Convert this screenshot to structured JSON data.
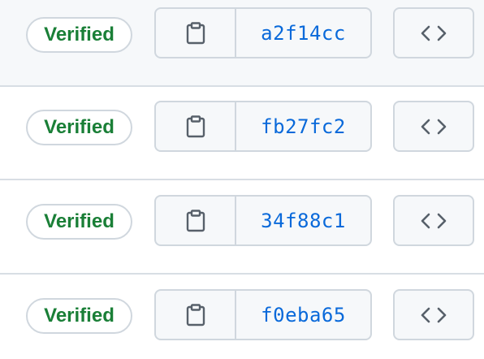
{
  "commits": [
    {
      "verified_label": "Verified",
      "sha": "a2f14cc"
    },
    {
      "verified_label": "Verified",
      "sha": "fb27fc2"
    },
    {
      "verified_label": "Verified",
      "sha": "34f88c1"
    },
    {
      "verified_label": "Verified",
      "sha": "f0eba65"
    }
  ],
  "icons": {
    "copy": "copy-icon",
    "browse": "code-icon"
  },
  "colors": {
    "verified_text": "#1a7f37",
    "sha_link": "#0969da",
    "border": "#d0d7de",
    "button_bg": "#f6f8fa",
    "icon": "#57606a"
  }
}
